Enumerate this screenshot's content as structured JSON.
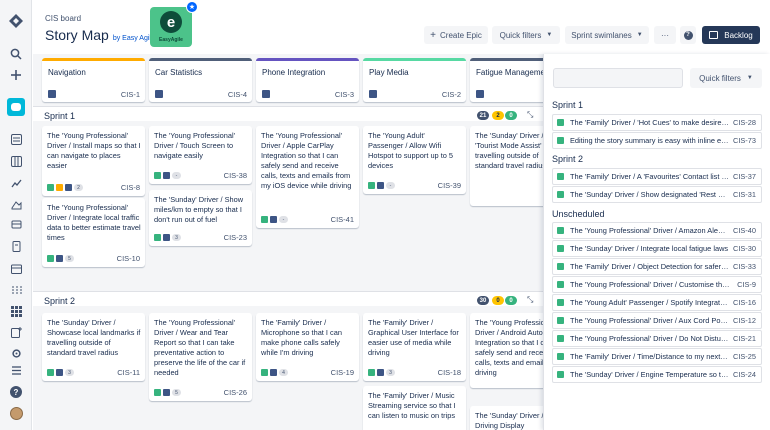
{
  "header": {
    "board_name": "CIS board",
    "title": "Story Map",
    "by": "by Easy Agile",
    "logo_text": "EasyAgile",
    "create_epic": "Create Epic",
    "quick_filters": "Quick filters",
    "sprint_swimlanes": "Sprint swimlanes",
    "more": "···",
    "backlog": "Backlog"
  },
  "epics": [
    {
      "name": "Navigation",
      "key": "CIS-1",
      "color": "#ffab00"
    },
    {
      "name": "Car Statistics",
      "key": "CIS-4",
      "color": "#505f79"
    },
    {
      "name": "Phone Integration",
      "key": "CIS-3",
      "color": "#6554c0"
    },
    {
      "name": "Play Media",
      "key": "CIS-2",
      "color": "#57d9a3"
    },
    {
      "name": "Fatigue Management",
      "key": "",
      "color": "#505f79"
    }
  ],
  "sprints": [
    {
      "name": "Sprint 1",
      "badges": [
        "21",
        "2",
        "0"
      ]
    },
    {
      "name": "Sprint 2",
      "badges": [
        "30",
        "0",
        "0"
      ]
    }
  ],
  "cards": [
    {
      "text": "The 'Young Professional' Driver / Install maps so that I can navigate to places easier",
      "key": "CIS-8",
      "points": "2"
    },
    {
      "text": "The 'Young Professional' Driver / Integrate local traffic data to better estimate travel times",
      "key": "CIS-10",
      "points": "5"
    },
    {
      "text": "The 'Young Professional' Driver / Touch Screen to navigate easily",
      "key": "CIS-38",
      "points": "-"
    },
    {
      "text": "The 'Sunday' Driver / Show miles/km to empty so that I don't run out of fuel",
      "key": "CIS-23",
      "points": "3"
    },
    {
      "text": "The 'Young Professional' Driver / Apple CarPlay Integration so that I can safely send and receive calls, texts and emails from my iOS device while driving",
      "key": "CIS-41",
      "points": "-"
    },
    {
      "text": "The 'Young Adult' Passenger / Allow Wifi Hotspot to support up to 5 devices",
      "key": "CIS-39",
      "points": "-"
    },
    {
      "text": "The 'Sunday' Driver / Enable 'Tourist Mode Assist' when travelling outside of standard travel radius",
      "key": "",
      "points": ""
    },
    {
      "text": "The 'Sunday' Driver / Showcase local landmarks if travelling outside of standard travel radius",
      "key": "CIS-11",
      "points": "3"
    },
    {
      "text": "The 'Young Professional' Driver / Wear and Tear Report so that I can take preventative action to preserve the life of the car if needed",
      "key": "CIS-26",
      "points": "5"
    },
    {
      "text": "The 'Family' Driver / Microphone so that I can make phone calls safely while I'm driving",
      "key": "CIS-19",
      "points": "4"
    },
    {
      "text": "The 'Family' Driver / Graphical User Interface for easier use of media while driving",
      "key": "CIS-18",
      "points": "3"
    },
    {
      "text": "The 'Family' Driver / Music Streaming service so that I can listen to music on trips",
      "key": "",
      "points": ""
    },
    {
      "text": "The 'Young Professional' Driver / Android Auto Integration so that I can safely send and receive calls, texts and emails while driving",
      "key": "",
      "points": ""
    },
    {
      "text": "The 'Sunday' Driver / Time Driving Display",
      "key": "",
      "points": ""
    }
  ],
  "panel": {
    "quick_filters": "Quick filters",
    "sections": [
      {
        "name": "Sprint 1",
        "items": [
          {
            "text": "The 'Family' Driver / 'Hot Cues' to make desired destination search easier",
            "key": "CIS-28"
          },
          {
            "text": "Editing the story summary is easy with inline editing",
            "key": "CIS-73"
          }
        ]
      },
      {
        "name": "Sprint 2",
        "items": [
          {
            "text": "The 'Family' Driver / A 'Favourites' Contact list so that I can call quickly",
            "key": "CIS-37"
          },
          {
            "text": "The 'Sunday' Driver / Show designated 'Rest Stops' on long trips",
            "key": "CIS-31"
          }
        ]
      },
      {
        "name": "Unscheduled",
        "items": [
          {
            "text": "The 'Young Professional' Driver / Amazon Alexa Integration",
            "key": "CIS-40"
          },
          {
            "text": "The 'Sunday' Driver / Integrate local fatigue laws",
            "key": "CIS-30"
          },
          {
            "text": "The 'Family' Driver / Object Detection for safer parking",
            "key": "CIS-33"
          },
          {
            "text": "The 'Young Professional' Driver / Customise the dashboard display",
            "key": "CIS-9"
          },
          {
            "text": "The 'Young Adult' Passenger / Spotify Integration",
            "key": "CIS-16"
          },
          {
            "text": "The 'Young Professional' Driver / Aux Cord Port for older devices",
            "key": "CIS-12"
          },
          {
            "text": "The 'Young Professional' Driver / Do Not Disturb mode while driving",
            "key": "CIS-21"
          },
          {
            "text": "The 'Family' Driver / Time/Distance to my next destination",
            "key": "CIS-25"
          },
          {
            "text": "The 'Sunday' Driver / Engine Temperature so that I know when to stop",
            "key": "CIS-24"
          }
        ]
      }
    ]
  }
}
